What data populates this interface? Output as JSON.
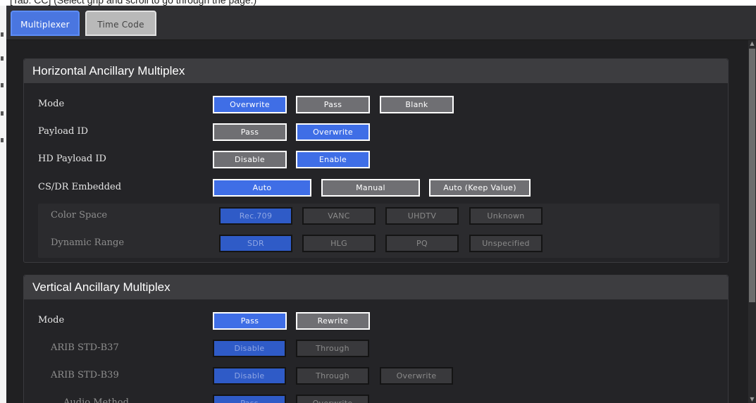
{
  "browser_strip_text": "[Tab: CC] (Select grip and scroll to go through the page.)",
  "tabs": [
    {
      "label": "Multiplexer",
      "active": true
    },
    {
      "label": "Time Code",
      "active": false
    }
  ],
  "hanc": {
    "title": "Horizontal Ancillary Multiplex",
    "mode": {
      "label": "Mode",
      "options": [
        "Overwrite",
        "Pass",
        "Blank"
      ],
      "selected": "Overwrite"
    },
    "payload_id": {
      "label": "Payload ID",
      "options": [
        "Pass",
        "Overwrite"
      ],
      "selected": "Overwrite"
    },
    "hd_payload_id": {
      "label": "HD Payload ID",
      "options": [
        "Disable",
        "Enable"
      ],
      "selected": "Enable"
    },
    "csdr": {
      "label": "CS/DR Embedded",
      "options": [
        "Auto",
        "Manual",
        "Auto (Keep Value)"
      ],
      "selected": "Auto"
    },
    "color_space": {
      "label": "Color Space",
      "options": [
        "Rec.709",
        "VANC",
        "UHDTV",
        "Unknown"
      ],
      "selected": "Rec.709"
    },
    "dynamic_range": {
      "label": "Dynamic Range",
      "options": [
        "SDR",
        "HLG",
        "PQ",
        "Unspecified"
      ],
      "selected": "SDR"
    }
  },
  "vanc": {
    "title": "Vertical Ancillary Multiplex",
    "mode": {
      "label": "Mode",
      "options": [
        "Pass",
        "Rewrite"
      ],
      "selected": "Pass"
    },
    "b37": {
      "label": "ARIB STD-B37",
      "options": [
        "Disable",
        "Through"
      ],
      "selected": "Disable"
    },
    "b39": {
      "label": "ARIB STD-B39",
      "options": [
        "Disable",
        "Through",
        "Overwrite"
      ],
      "selected": "Disable"
    },
    "audio": {
      "label": "Audio Method",
      "options": [
        "Pass",
        "Overwrite"
      ],
      "selected": "Pass"
    }
  },
  "colors": {
    "accent": "#3f6ee6",
    "panel": "#202022",
    "header": "#3d3d40"
  }
}
